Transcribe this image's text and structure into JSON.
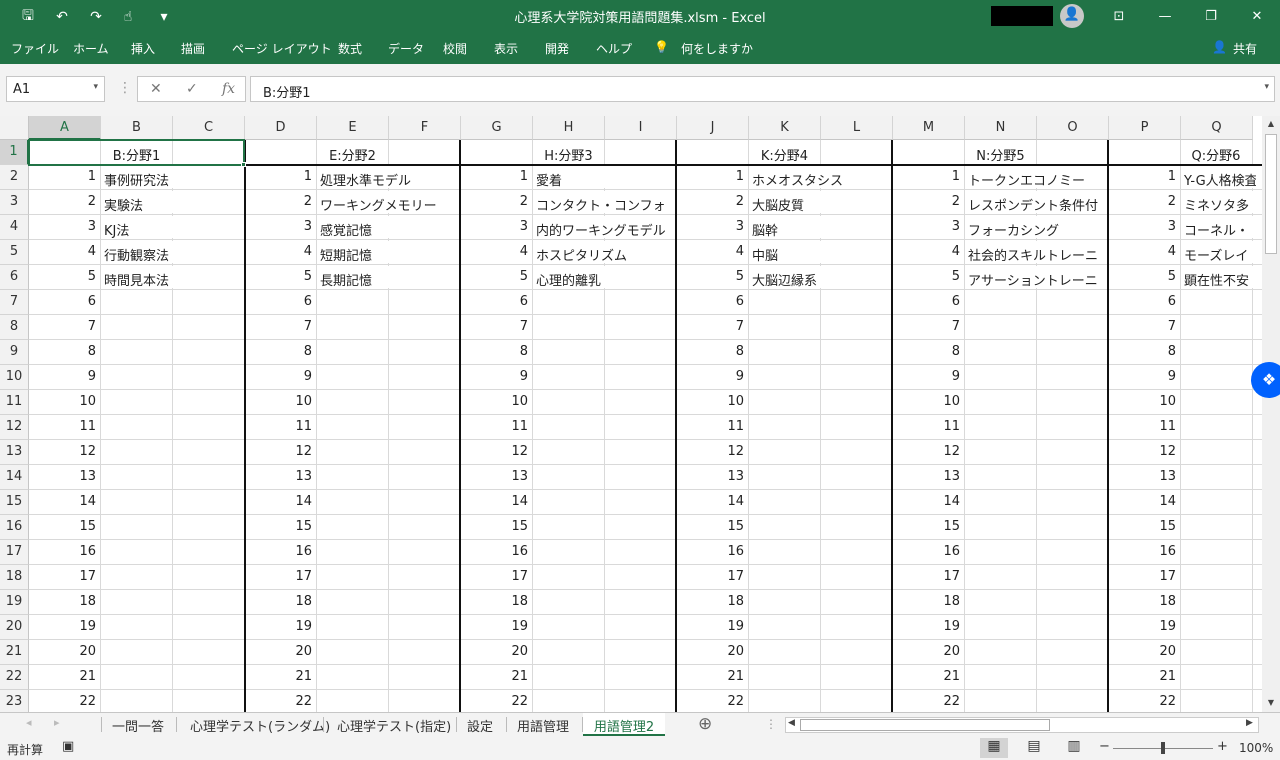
{
  "titlebar": {
    "title": "心理系大学院対策用語問題集.xlsm  -  Excel",
    "icons": [
      "save-icon",
      "undo-icon",
      "redo-icon",
      "touch-mode-icon",
      "customize-icon"
    ],
    "account_redacted": true,
    "glyphs": {
      "save": "🖫",
      "undo": "↶",
      "redo": "↷",
      "touch": "☝",
      "more": "▾",
      "user": "👤",
      "ribbon_opts": "⊡",
      "min": "—",
      "max": "❐",
      "close": "✕"
    }
  },
  "ribbon": {
    "tabs": [
      "ファイル",
      "ホーム",
      "挿入",
      "描画",
      "ページ レイアウト",
      "数式",
      "データ",
      "校閲",
      "表示",
      "開発",
      "ヘルプ",
      "何をしますか"
    ],
    "share": "共有",
    "tell_glyph": "💡",
    "share_glyph": "👤"
  },
  "formula_bar": {
    "name_box": "A1",
    "cancel": "✕",
    "enter": "✓",
    "fx": "fx",
    "value": "B:分野1",
    "dropdown": "▾",
    "more": "⋮"
  },
  "grid": {
    "columns": [
      "A",
      "B",
      "C",
      "D",
      "E",
      "F",
      "G",
      "H",
      "I",
      "J",
      "K",
      "L",
      "M",
      "N",
      "O",
      "P",
      "Q"
    ],
    "selected_column": "A",
    "rows": [
      1,
      2,
      3,
      4,
      5,
      6,
      7,
      8,
      9,
      10,
      11,
      12,
      13,
      14,
      15,
      16,
      17,
      18,
      19,
      20,
      21,
      22,
      23
    ],
    "selected_row": 1,
    "groups": [
      {
        "header": "B:分野1",
        "terms": [
          "事例研究法",
          "実験法",
          "KJ法",
          "行動観察法",
          "時間見本法"
        ]
      },
      {
        "header": "E:分野2",
        "terms": [
          "処理水準モデル",
          "ワーキングメモリー",
          "感覚記憶",
          "短期記憶",
          "長期記憶"
        ]
      },
      {
        "header": "H:分野3",
        "terms": [
          "愛着",
          "コンタクト・コンフォ",
          "内的ワーキングモデル",
          "ホスピタリズム",
          "心理的離乳"
        ]
      },
      {
        "header": "K:分野4",
        "terms": [
          "ホメオスタシス",
          "大脳皮質",
          "脳幹",
          "中脳",
          "大脳辺縁系"
        ]
      },
      {
        "header": "N:分野5",
        "terms": [
          "トークンエコノミー",
          "レスポンデント条件付",
          "フォーカシング",
          "社会的スキルトレーニ",
          "アサーショントレーニ"
        ]
      },
      {
        "header": "Q:分野6",
        "terms": [
          "Y-G人格検査",
          "ミネソタ多",
          "コーネル・",
          "モーズレイ",
          "顕在性不安"
        ]
      }
    ],
    "numbers": [
      1,
      2,
      3,
      4,
      5,
      6,
      7,
      8,
      9,
      10,
      11,
      12,
      13,
      14,
      15,
      16,
      17,
      18,
      19,
      20,
      21,
      22
    ]
  },
  "sheet_tabs": {
    "tabs": [
      "一問一答",
      "心理学テスト(ランダム)",
      "心理学テスト(指定)",
      "設定",
      "用語管理",
      "用語管理2"
    ],
    "active": "用語管理2",
    "add_glyph": "⊕",
    "prev_glyph": "◂",
    "next_glyph": "▸",
    "more": "⋮"
  },
  "statusbar": {
    "mode": "再計算",
    "zoom": "100%",
    "zoom_out": "−",
    "zoom_in": "+",
    "view_icons": [
      "normal-view-icon",
      "page-layout-view-icon",
      "page-break-view-icon"
    ],
    "view_glyphs": [
      "▦",
      "▤",
      "▥"
    ],
    "macro_glyph": "▣"
  },
  "dropbox": {
    "glyph": "❖"
  },
  "colors": {
    "excel_green": "#217346",
    "grid_line": "#d9d9d9",
    "dropbox_blue": "#0061fe"
  }
}
